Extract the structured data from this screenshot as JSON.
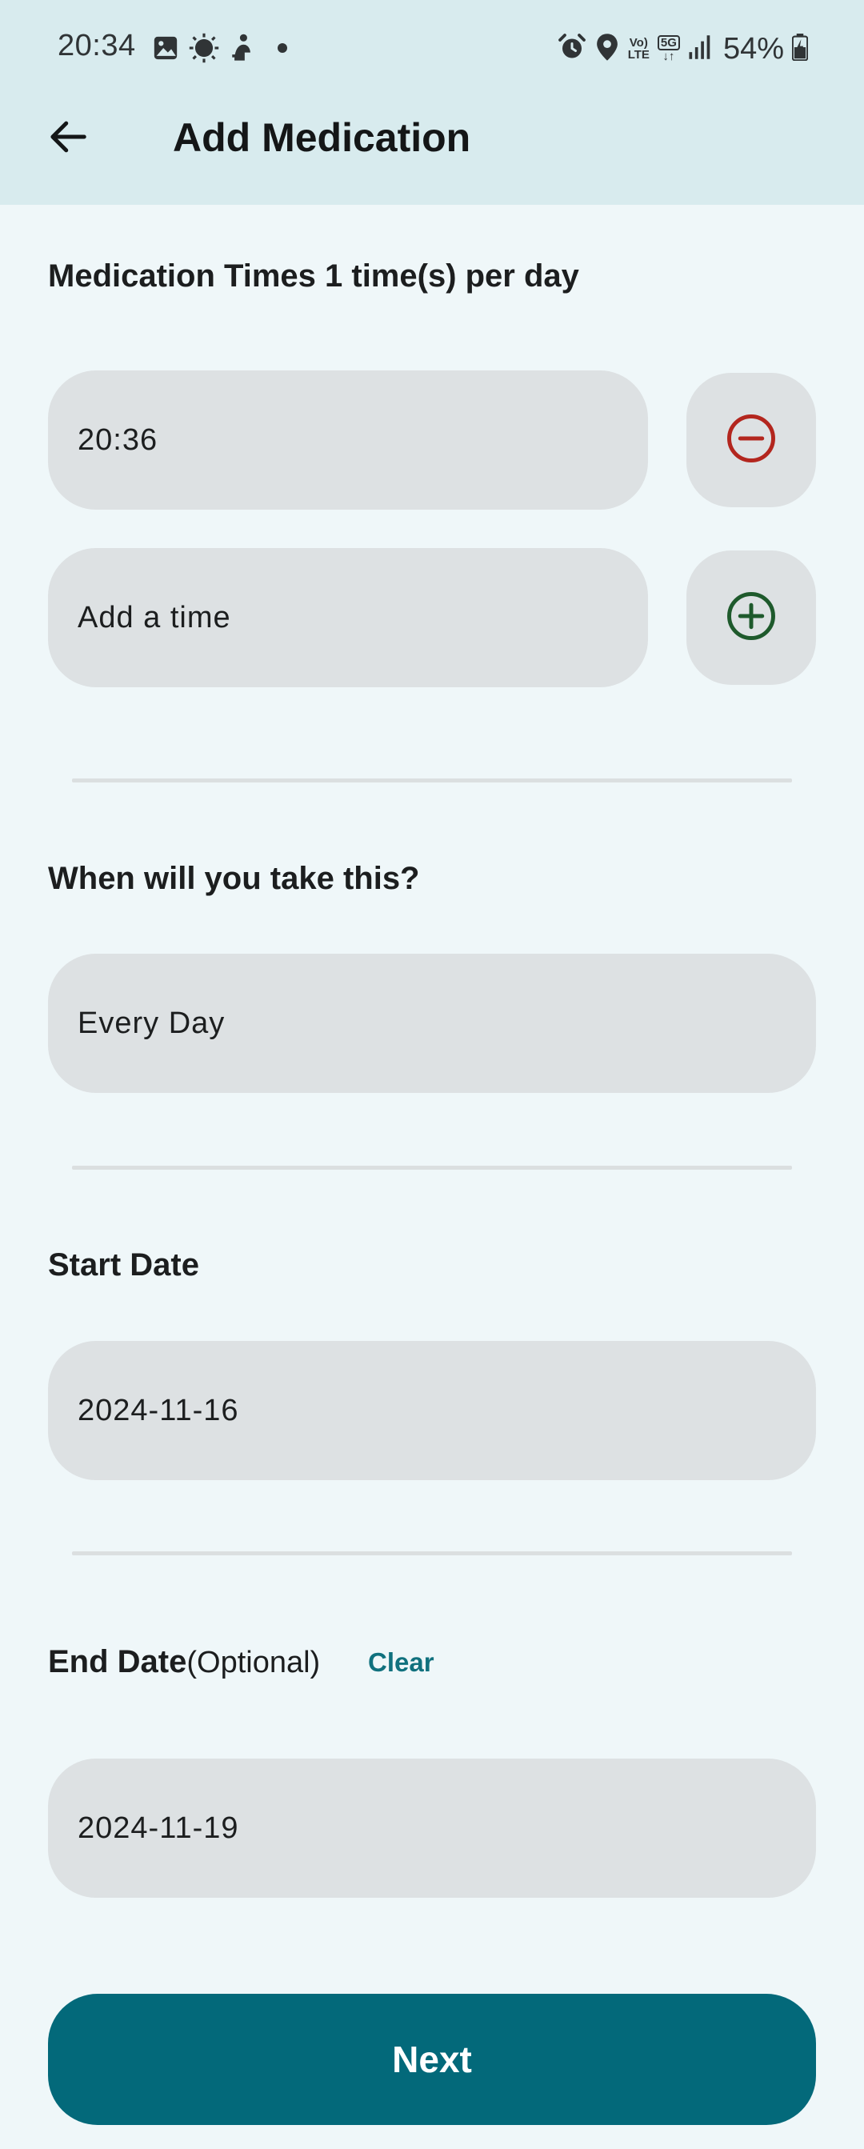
{
  "status_bar": {
    "time": "20:34",
    "battery": "54%",
    "network_top": "Vo)",
    "network_bottom": "LTE",
    "gen_top": "5G",
    "gen_bottom": "↓↑"
  },
  "app_bar": {
    "title": "Add Medication"
  },
  "medication_times": {
    "title": "Medication Times 1 time(s) per day",
    "times": [
      {
        "value": "20:36"
      }
    ],
    "add_placeholder": "Add a time"
  },
  "schedule": {
    "title": "When will you take this?",
    "value": "Every Day"
  },
  "start_date": {
    "title": "Start Date",
    "value": "2024-11-16"
  },
  "end_date": {
    "title": "End Date",
    "optional_label": "(Optional)",
    "clear_label": "Clear",
    "value": "2024-11-19"
  },
  "footer": {
    "next_label": "Next"
  },
  "colors": {
    "accent": "#03697a",
    "remove": "#b3261e",
    "add": "#1e5a2c",
    "field_bg": "#dde1e3",
    "header_bg": "#d8ebee"
  },
  "icons": [
    "image-icon",
    "sun-icon",
    "person-icon",
    "dot-icon",
    "alarm-icon",
    "location-icon",
    "signal-icon",
    "battery-icon",
    "back-arrow-icon",
    "remove-circle-icon",
    "add-circle-icon"
  ]
}
